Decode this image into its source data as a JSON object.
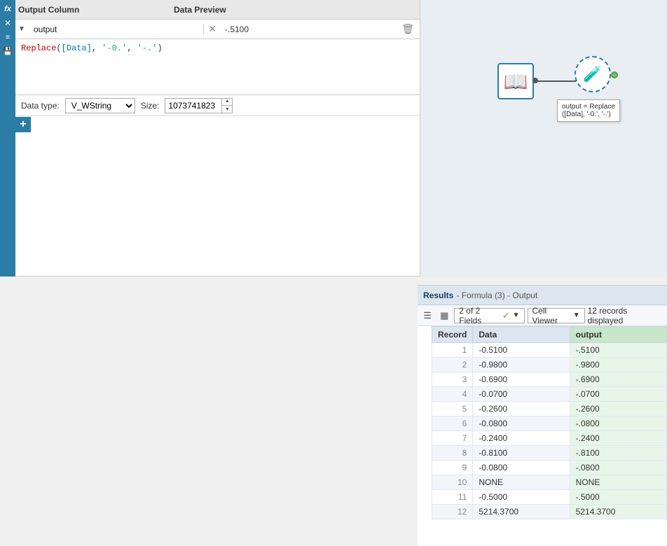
{
  "top_panel": {
    "column_header": "Output Column",
    "preview_header": "Data Preview",
    "output_field": {
      "name": "output",
      "preview_value": "-.5100"
    },
    "formula": "Replace([Data], '-0.', '-.')",
    "datatype": {
      "label": "Data type:",
      "value": "V_WString",
      "size_label": "Size:",
      "size_value": "1073741823"
    }
  },
  "toolbar_icons": [
    "fx",
    "×",
    "≡",
    "💾"
  ],
  "workflow": {
    "node_book_icon": "📖",
    "node_formula_icon": "🧪",
    "tooltip_text": "output = Replace\n([Data], '-0.', '-.')"
  },
  "results": {
    "title": "Results",
    "subtitle": "- Formula (3) - Output",
    "fields_label": "2 of 2 Fields",
    "cell_viewer_label": "Cell Viewer",
    "records_info": "12 records displayed",
    "columns": [
      "Record",
      "Data",
      "output"
    ],
    "rows": [
      {
        "record": "1",
        "data": "-0.5100",
        "output": "-.5100"
      },
      {
        "record": "2",
        "data": "-0.9800",
        "output": "-.9800"
      },
      {
        "record": "3",
        "data": "-0.6900",
        "output": "-.6900"
      },
      {
        "record": "4",
        "data": "-0.0700",
        "output": "-.0700"
      },
      {
        "record": "5",
        "data": "-0.2600",
        "output": "-.2600"
      },
      {
        "record": "6",
        "data": "-0.0800",
        "output": "-.0800"
      },
      {
        "record": "7",
        "data": "-0.2400",
        "output": "-.2400"
      },
      {
        "record": "8",
        "data": "-0.8100",
        "output": "-.8100"
      },
      {
        "record": "9",
        "data": "-0.0800",
        "output": "-.0800"
      },
      {
        "record": "10",
        "data": "NONE",
        "output": "NONE"
      },
      {
        "record": "11",
        "data": "-0.5000",
        "output": "-.5000"
      },
      {
        "record": "12",
        "data": "5214.3700",
        "output": "5214.3700"
      }
    ]
  },
  "add_button_label": "+",
  "colors": {
    "toolbar_bg": "#2b7da6",
    "header_bg": "#e8e8e8",
    "output_col_bg": "#c8e6c9",
    "results_header_bg": "#dce6f0"
  }
}
